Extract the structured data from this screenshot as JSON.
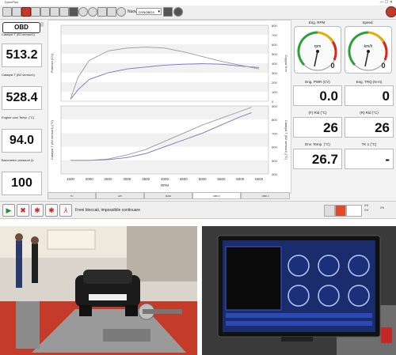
{
  "window": {
    "title": "DynoPlus"
  },
  "toolbar": {
    "nuovo_label": "Nuovo",
    "profile_value": "DYNOBOX"
  },
  "left_panel": {
    "obd_label": "OBD",
    "readouts": [
      {
        "label": "Catalyst T (B1 sensor1)",
        "value": "513.2"
      },
      {
        "label": "Catalyst T (B2 sensor1)",
        "value": "528.4"
      },
      {
        "label": "Engine cool Temp. (°C)",
        "value": "94.0"
      },
      {
        "label": "Barometric pressure (k",
        "value": "100"
      }
    ]
  },
  "chart_data": [
    {
      "type": "line",
      "ylabel": "Potenza (CV)",
      "y2label": "Coppia N·m",
      "y2ticks": [
        "800",
        "700",
        "600",
        "500",
        "400",
        "300",
        "200",
        "100",
        "0"
      ],
      "series": [
        {
          "x": [
            1500,
            1700,
            2000,
            2500,
            3000,
            3500,
            4000,
            4500,
            5000,
            5500,
            6000,
            6500
          ],
          "values": [
            20,
            120,
            230,
            300,
            340,
            360,
            380,
            390,
            395,
            390,
            370,
            355
          ]
        },
        {
          "x": [
            1500,
            1700,
            2000,
            2500,
            3000,
            3500,
            4000,
            4500,
            5000,
            5500,
            6000,
            6500
          ],
          "values": [
            20,
            250,
            430,
            530,
            560,
            570,
            560,
            520,
            470,
            420,
            380,
            340
          ]
        }
      ]
    },
    {
      "type": "line",
      "xlabel": "RPM",
      "ylabel": "Catalyst T (B1 sensor1) (°C)",
      "y2label": "Catalyst T (B2 sensor1) (°C)",
      "y2ticks": [
        "900",
        "800",
        "700",
        "600",
        "500",
        "400"
      ],
      "xticks": [
        "1500",
        "2000",
        "2500",
        "3000",
        "3500",
        "4000",
        "4500",
        "5000",
        "5500",
        "6000",
        "6500"
      ],
      "xlim": [
        1250,
        6750
      ],
      "series": [
        {
          "x": [
            1500,
            2000,
            2500,
            3000,
            3500,
            4000,
            4500,
            5000,
            5500,
            6000,
            6300
          ],
          "values": [
            500,
            500,
            505,
            520,
            550,
            600,
            650,
            700,
            760,
            820,
            850
          ]
        },
        {
          "x": [
            1500,
            2000,
            2500,
            3000,
            3500,
            4000,
            4500,
            5000,
            5500,
            6000,
            6300
          ],
          "values": [
            500,
            500,
            510,
            540,
            580,
            640,
            700,
            760,
            810,
            860,
            890
          ]
        }
      ]
    }
  ],
  "chart_tabs": [
    "TC",
    "API",
    "RAW",
    "OBD II",
    "OBD 2"
  ],
  "right_panel": {
    "gauges": [
      {
        "label": "Eng. RPM",
        "unit": "rpm",
        "value": "0"
      },
      {
        "label": "Speed",
        "unit": "km/h",
        "value": "0"
      }
    ],
    "displays": [
      {
        "label": "Eng. PWR (CV)",
        "value": "0.0"
      },
      {
        "label": "Eng. TRQ (N·m)",
        "value": "0"
      },
      {
        "label": "(F) Rid (°C)",
        "value": "26"
      },
      {
        "label": "(R) Rid (°C)",
        "value": "26"
      },
      {
        "label": "Env. Temp. (°C)",
        "value": "26.7"
      },
      {
        "label": "TK 1 (°C)",
        "value": "-"
      }
    ]
  },
  "status_bar": {
    "message": "Freni bloccati, impossibile continuare",
    "small_values": [
      "0%",
      "0%",
      "0%"
    ]
  },
  "colors": {
    "series_a": "#7a6fc4",
    "series_b": "#9a9a9a",
    "gauge_green": "#2e9e3b",
    "gauge_yellow": "#e0b000",
    "gauge_red": "#d42a1b",
    "play_green": "#2e8b2e",
    "stop_red": "#c62828"
  }
}
